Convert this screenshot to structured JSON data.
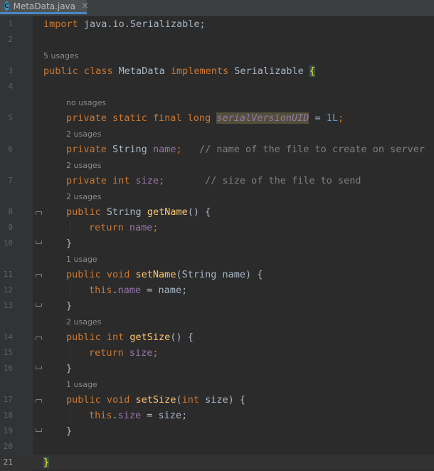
{
  "tab": {
    "filename": "MetaData.java",
    "icon_letter": "C",
    "close_glyph": "×"
  },
  "hints": {
    "h1": "5 usages",
    "h2": "no usages",
    "h3": "2 usages",
    "h4": "2 usages",
    "h5": "2 usages",
    "h6": "1 usage",
    "h7": "2 usages",
    "h8": "1 usage"
  },
  "lines": {
    "n1": "1",
    "n2": "2",
    "n3": "3",
    "n4": "4",
    "n5": "5",
    "n6": "6",
    "n7": "7",
    "n8": "8",
    "n9": "9",
    "n10": "10",
    "n11": "11",
    "n12": "12",
    "n13": "13",
    "n14": "14",
    "n15": "15",
    "n16": "16",
    "n17": "17",
    "n18": "18",
    "n19": "19",
    "n20": "20",
    "n21": "21"
  },
  "code": {
    "l1_kw": "import",
    "l1_rest": " java.io.Serializable;",
    "l3_kw1": "public class",
    "l3_name": " MetaData ",
    "l3_kw2": "implements",
    "l3_iface": " Serializable ",
    "l3_brace": "{",
    "l5_kw": "private static final long ",
    "l5_fld": "serialVersionUID",
    "l5_eq": " = ",
    "l5_num": "1L",
    "l5_semi": ";",
    "l6_kw": "private",
    "l6_type": " String ",
    "l6_fld": "name",
    "l6_semi": ";   ",
    "l6_cmt": "// name of the file to create on server",
    "l7_kw": "private int ",
    "l7_fld": "size",
    "l7_semi": ";       ",
    "l7_cmt": "// size of the file to send",
    "l8_kw": "public",
    "l8_type": " String ",
    "l8_fn": "getName",
    "l8_rest": "() {",
    "l9_kw": "return ",
    "l9_fld": "name",
    "l9_semi": ";",
    "close": "}",
    "l11_kw": "public void ",
    "l11_fn": "setName",
    "l11_rest": "(String name) {",
    "l12_kw": "this",
    "l12_dot": ".",
    "l12_fld": "name",
    "l12_rest": " = name;",
    "l14_kw": "public int ",
    "l14_fn": "getSize",
    "l14_rest": "() {",
    "l15_kw": "return ",
    "l15_fld": "size",
    "l15_semi": ";",
    "l17_kw": "public void ",
    "l17_fn": "setSize",
    "l17_p1": "(",
    "l17_kw2": "int",
    "l17_p2": " size) {",
    "l18_kw": "this",
    "l18_dot": ".",
    "l18_fld": "size",
    "l18_rest": " = size;",
    "l21_brace": "}"
  },
  "colors": {
    "background": "#2b2b2b",
    "keyword": "#cc7832",
    "field": "#9876aa",
    "method": "#ffc66d",
    "number": "#6897bb",
    "comment": "#808080",
    "text": "#a9b7c6"
  }
}
